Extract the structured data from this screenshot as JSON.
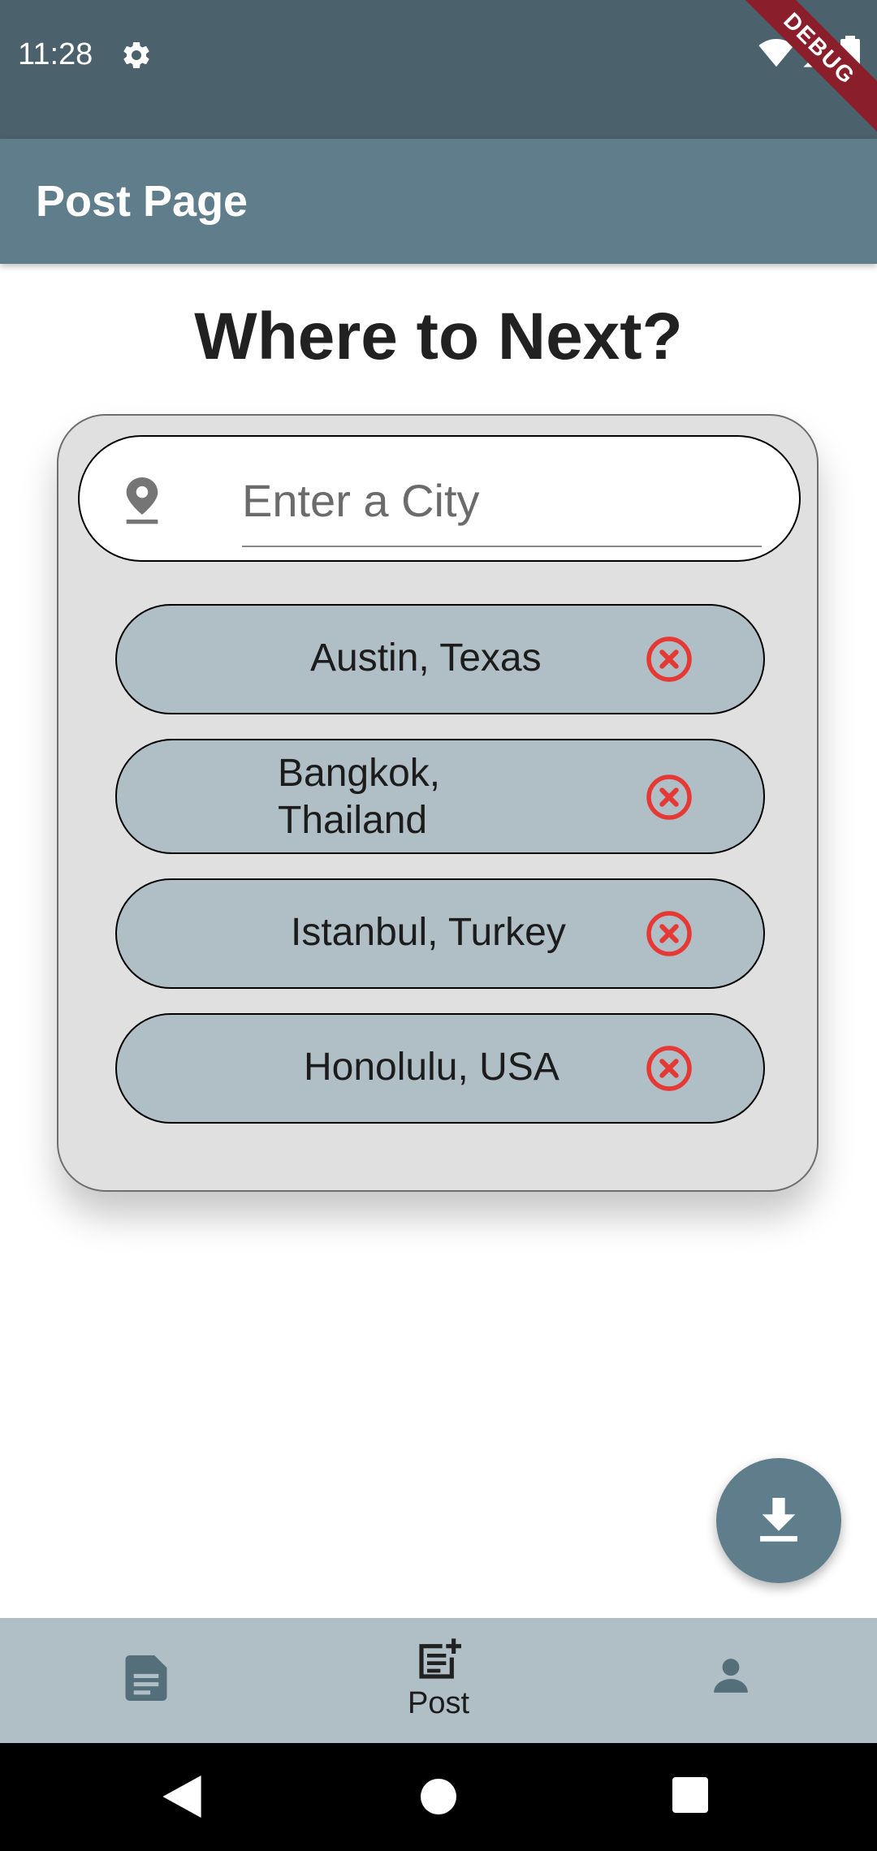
{
  "status_bar": {
    "time": "11:28",
    "settings_icon": "gear-icon",
    "wifi_icon": "wifi-icon",
    "signal_icon": "cell-signal-icon",
    "battery_icon": "battery-icon",
    "debug_banner": "DEBUG",
    "background_color": "#4b616c"
  },
  "app_bar": {
    "title": "Post Page",
    "background_color": "#607d8b"
  },
  "main": {
    "heading": "Where to Next?"
  },
  "search": {
    "icon": "location-pin-icon",
    "placeholder": "Enter a City",
    "value": ""
  },
  "cities": [
    {
      "label": "Austin, Texas",
      "remove_icon": "cancel-circle-icon"
    },
    {
      "label": "Bangkok,\nThailand",
      "remove_icon": "cancel-circle-icon"
    },
    {
      "label": "Istanbul, Turkey",
      "remove_icon": "cancel-circle-icon"
    },
    {
      "label": "Honolulu, USA",
      "remove_icon": "cancel-circle-icon"
    }
  ],
  "fab": {
    "icon": "download-icon"
  },
  "bottom_nav": {
    "items": [
      {
        "icon": "article-icon",
        "label": ""
      },
      {
        "icon": "post-add-icon",
        "label": "Post",
        "selected": true
      },
      {
        "icon": "person-icon",
        "label": ""
      }
    ],
    "background_color": "#b0bec5"
  },
  "system_nav": {
    "back_icon": "back-triangle-icon",
    "home_icon": "home-circle-icon",
    "recents_icon": "recents-square-icon"
  },
  "colors": {
    "accent": "#607d8b",
    "chip": "#b0bec5",
    "remove": "#e53935",
    "card": "#e0e0e0"
  }
}
